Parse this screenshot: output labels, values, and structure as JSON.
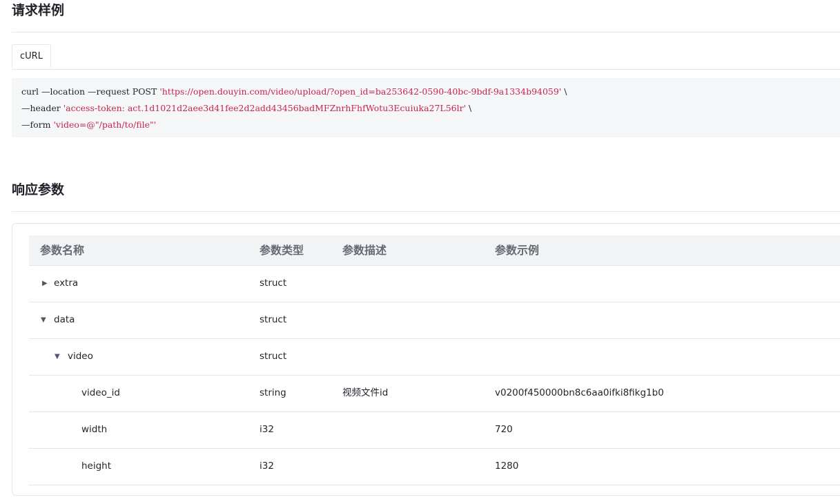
{
  "request_section": {
    "title": "请求样例",
    "tab_label": "cURL",
    "code": {
      "line1_cmd": "curl —location —request POST ",
      "line1_url": "'https://open.douyin.com/video/upload/?open_id=ba253642-0590-40bc-9bdf-9a1334b94059'",
      "line1_tail": " \\",
      "line2_cmd": "—header ",
      "line2_val": "'access-token: act.1d1021d2aee3d41fee2d2add43456badMFZnrhFhfWotu3Ecuiuka27L56lr'",
      "line2_tail": " \\",
      "line3_cmd": "—form ",
      "line3_val": "'video=@\"/path/to/file\"'"
    }
  },
  "response_section": {
    "title": "响应参数",
    "columns": [
      "参数名称",
      "参数类型",
      "参数描述",
      "参数示例"
    ],
    "rows": [
      {
        "name": "extra",
        "type": "struct",
        "desc": "",
        "example": "",
        "caret": "▶"
      },
      {
        "name": "data",
        "type": "struct",
        "desc": "",
        "example": "",
        "caret": "▼"
      },
      {
        "name": "video",
        "type": "struct",
        "desc": "",
        "example": "",
        "caret": "▼"
      },
      {
        "name": "video_id",
        "type": "string",
        "desc": "视频文件id",
        "example": "v0200f450000bn8c6aa0ifki8fikg1b0",
        "caret": ""
      },
      {
        "name": "width",
        "type": "i32",
        "desc": "",
        "example": "720",
        "caret": ""
      },
      {
        "name": "height",
        "type": "i32",
        "desc": "",
        "example": "1280",
        "caret": ""
      }
    ]
  },
  "colors": {
    "code_string": "#c7254e",
    "header_bg": "#f2f3f5",
    "code_bg": "#f5f6f7"
  }
}
